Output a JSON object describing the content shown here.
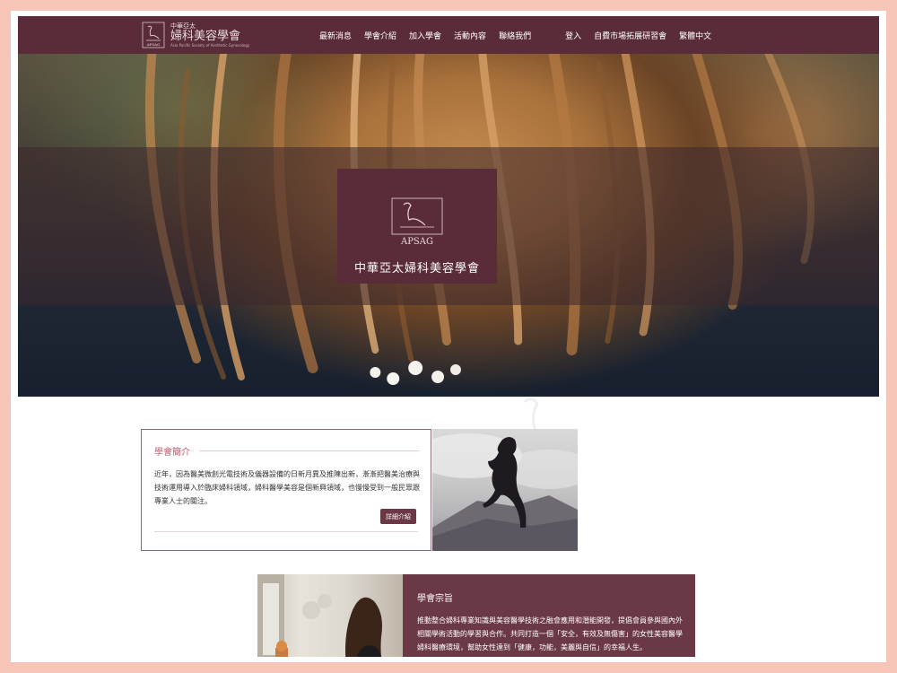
{
  "nav": {
    "logo_small": "中華亞太",
    "logo_main": "婦科美容學會",
    "logo_sub": "Asia Pacific Society of Aesthetic Gynecology",
    "logo_mark": "APSAG",
    "items": [
      "最新消息",
      "學會介紹",
      "加入學會",
      "活動內容",
      "聯絡我們",
      "登入",
      "自費市場拓展研習會",
      "繁體中文"
    ]
  },
  "hero": {
    "badge_mark": "APSAG",
    "badge_title": "中華亞太婦科美容學會"
  },
  "intro": {
    "heading": "學會簡介",
    "body": "近年，因為醫美微創光電技術及儀器設備的日新月異及推陳出新，漸漸把醫美治療與技術運用導入於臨床婦科領域，婦科醫學美容是個新興領域，也慢慢受到一般民眾跟專業人士的關注。",
    "button": "詳細介紹"
  },
  "purpose": {
    "heading": "學會宗旨",
    "body": "推動整合婦科專業知識與美容醫學技術之融會應用和潛能開發，提倡會員參與國內外相關學術活動的學習與合作。共同打造一個「安全，有效及無傷害」的女性美容醫學婦科醫療環境，幫助女性達到「健康，功能，美麗與自信」的幸福人生。"
  },
  "colors": {
    "brand": "#5a2c39",
    "accent": "#c4556c",
    "frame": "#f7c4b8"
  }
}
